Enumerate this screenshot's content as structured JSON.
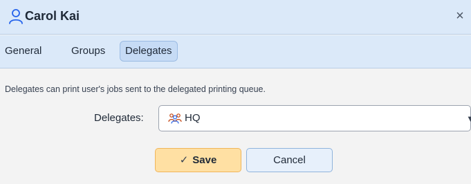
{
  "window": {
    "title": "Carol Kai",
    "title_icon": "user-icon",
    "close_label": "×"
  },
  "tabs": [
    {
      "label": "General",
      "active": false
    },
    {
      "label": "Groups",
      "active": false
    },
    {
      "label": "Delegates",
      "active": true
    }
  ],
  "delegates_panel": {
    "description": "Delegates can print user's jobs sent to the delegated printing queue.",
    "field_label": "Delegates:",
    "selected_value": "HQ",
    "selected_icon": "group-icon"
  },
  "actions": {
    "save_label": "Save",
    "cancel_label": "Cancel"
  },
  "colors": {
    "header_bg": "#dbe9f9",
    "active_tab_bg": "#c6dbf5",
    "save_bg": "#ffe0a3",
    "save_border": "#f0b55a",
    "cancel_bg": "#e7f0fb"
  }
}
